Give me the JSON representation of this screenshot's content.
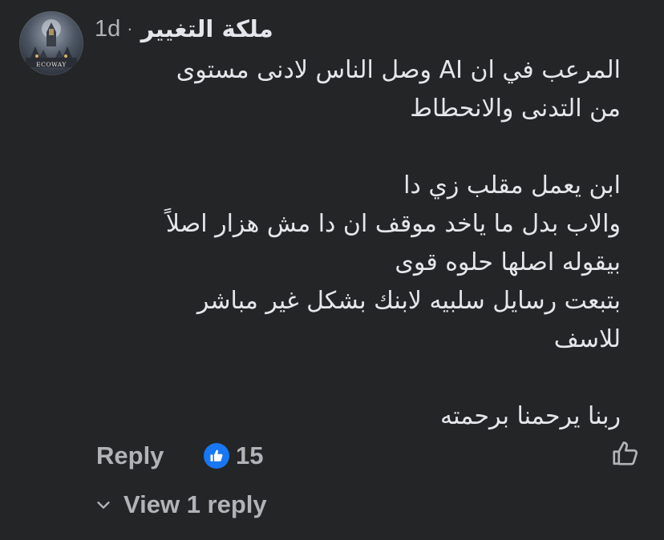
{
  "comment": {
    "author": "ملكة  التغيير",
    "time": "1d",
    "separator": "·",
    "avatar_text": "ECOWAY",
    "lines": [
      "المرعب في ان AI وصل الناس  لادنى مستوى",
      "من التدنى والانحطاط",
      "",
      "ابن يعمل مقلب زي دا",
      "والاب بدل ما ياخد موقف ان دا مش هزار اصلاً",
      "بيقوله اصلها  حلوه قوى",
      "بتبعت رسايل  سلبيه  لابنك بشكل غير مباشر",
      "للاسف",
      "",
      "ربنا يرحمنا برحمته"
    ]
  },
  "actions": {
    "reply_label": "Reply",
    "reaction_count": "15",
    "reaction_icon": "like-icon",
    "like_button_icon": "thumbs-up-outline-icon"
  },
  "replies": {
    "view_label": "View 1 reply",
    "icon": "chevron-down-icon"
  },
  "colors": {
    "background": "#242526",
    "text_primary": "#e4e6eb",
    "text_secondary": "#b0b3b8",
    "like_blue": "#1877f2"
  }
}
